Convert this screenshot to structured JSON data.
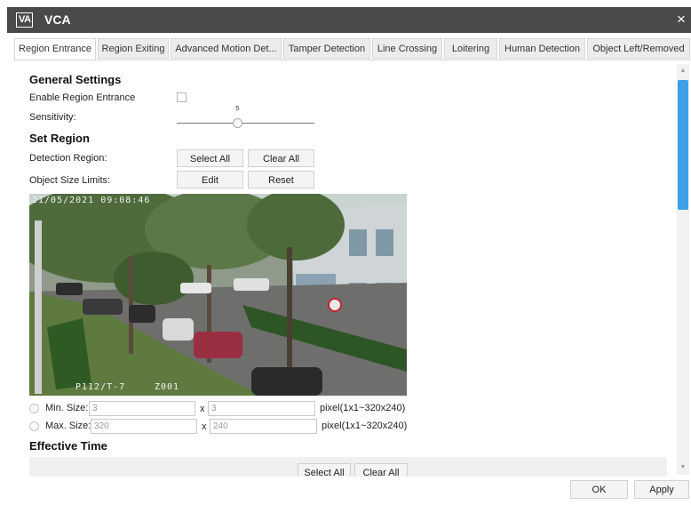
{
  "window": {
    "logo": "VA",
    "title": "VCA",
    "close": "×"
  },
  "tabs": [
    {
      "label": "Region Entrance",
      "active": true
    },
    {
      "label": "Region Exiting"
    },
    {
      "label": "Advanced Motion Det..."
    },
    {
      "label": "Tamper Detection"
    },
    {
      "label": "Line Crossing"
    },
    {
      "label": "Loitering"
    },
    {
      "label": "Human Detection"
    },
    {
      "label": "Object Left/Removed"
    }
  ],
  "general": {
    "heading": "General Settings",
    "enable_label": "Enable Region Entrance",
    "enable_checked": false,
    "sensitivity_label": "Sensitivity:",
    "sensitivity_value": "5",
    "sensitivity_fraction": 0.44
  },
  "region": {
    "heading": "Set Region",
    "detection_label": "Detection Region:",
    "select_all": "Select All",
    "clear_all": "Clear All",
    "size_label": "Object Size Limits:",
    "edit": "Edit",
    "reset": "Reset"
  },
  "camera": {
    "timestamp": "21/05/2021 09:08:46",
    "plate": "P112/T-7",
    "zone": "Z001"
  },
  "sizes": {
    "min_label": "Min. Size:",
    "min_w": "3",
    "min_h": "3",
    "max_label": "Max. Size:",
    "max_w": "320",
    "max_h": "240",
    "x": "x",
    "range": "pixel(1x1~320x240)"
  },
  "effective": {
    "heading": "Effective Time",
    "select_all": "Select All",
    "clear_all": "Clear All"
  },
  "footer": {
    "ok": "OK",
    "apply": "Apply"
  },
  "scroll": {
    "up": "▲",
    "down": "▼"
  },
  "colors": {
    "titlebar": "#4a4a4a",
    "scroll_thumb": "#3ea0e8"
  }
}
